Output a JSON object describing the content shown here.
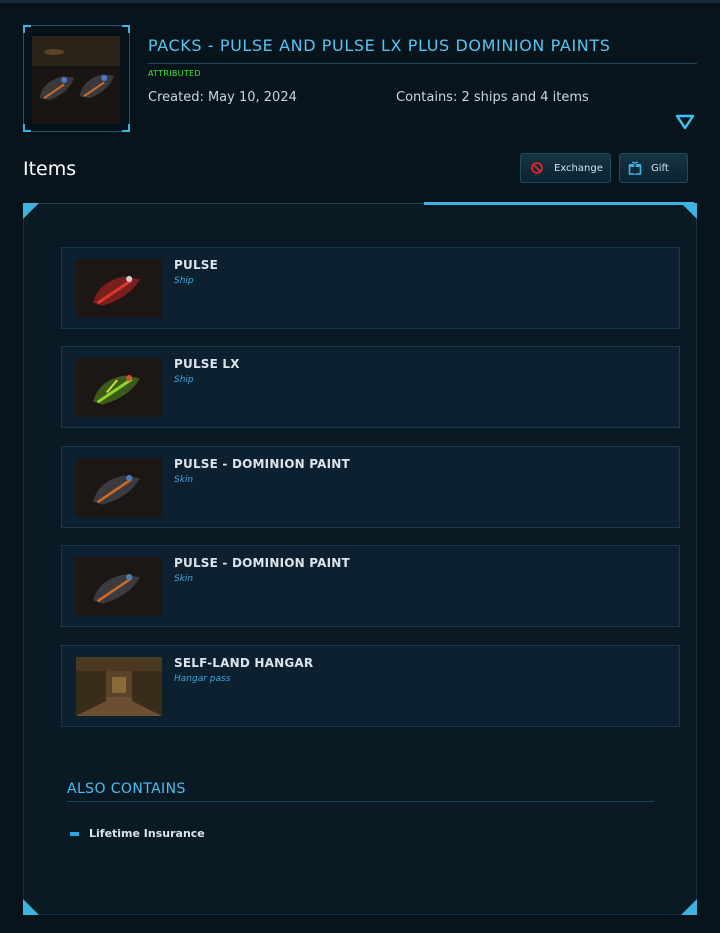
{
  "pack": {
    "title": "PACKS - PULSE AND PULSE LX PLUS DOMINION PAINTS",
    "status": "ATTRIBUTED",
    "created": "Created: May 10, 2024",
    "contains": "Contains: 2 ships and 4 items"
  },
  "items_section": {
    "heading": "Items",
    "exchange_label": "Exchange",
    "gift_label": "Gift"
  },
  "items": [
    {
      "name": "PULSE",
      "kind": "Ship"
    },
    {
      "name": "PULSE LX",
      "kind": "Ship"
    },
    {
      "name": "PULSE - DOMINION PAINT",
      "kind": "Skin"
    },
    {
      "name": "PULSE - DOMINION PAINT",
      "kind": "Skin"
    },
    {
      "name": "SELF-LAND HANGAR",
      "kind": "Hangar pass"
    }
  ],
  "also_contains": {
    "heading": "ALSO CONTAINS",
    "items": [
      "Lifetime Insurance"
    ]
  },
  "colors": {
    "accent": "#3fb3e0",
    "title": "#59c3f2",
    "status": "#3ee830",
    "exchange_icon": "#e0242a",
    "gift_icon": "#3fb3e0"
  },
  "icons": {
    "expand": "chevron-down-icon",
    "exchange": "exchange-icon",
    "gift": "gift-icon"
  }
}
